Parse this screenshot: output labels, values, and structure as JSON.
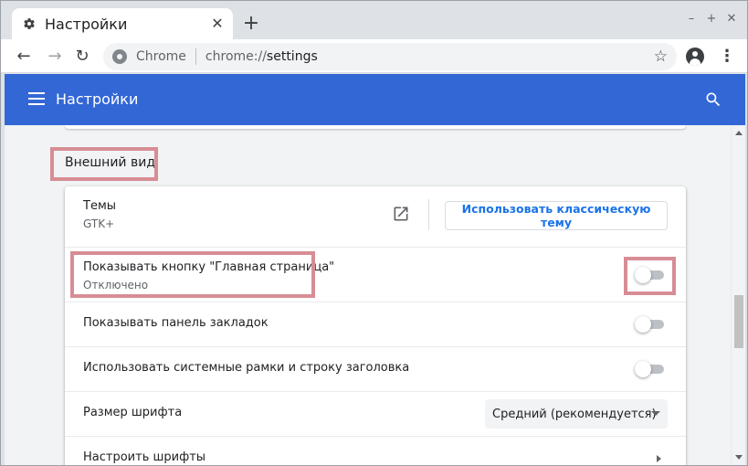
{
  "tab": {
    "title": "Настройки",
    "favicon": "gear-icon",
    "close": "✕"
  },
  "toolbar": {
    "back": "←",
    "forward": "→",
    "reload": "↻",
    "omnibox_chip": "Chrome",
    "url_scheme": "chrome://",
    "url_host": "settings",
    "star": "☆",
    "menu": "⋮",
    "new_tab": "+"
  },
  "window_controls": {
    "minimize": "–",
    "maximize": "+",
    "close": "✕"
  },
  "header": {
    "title": "Настройки",
    "accent": "#3367d6"
  },
  "appearance": {
    "section_title": "Внешний вид",
    "themes": {
      "label": "Темы",
      "value": "GTK+",
      "button": "Использовать классическую тему"
    },
    "home_button": {
      "label": "Показывать кнопку \"Главная страница\"",
      "status": "Отключено",
      "enabled": false
    },
    "bookmarks_bar": {
      "label": "Показывать панель закладок",
      "enabled": false
    },
    "system_frames": {
      "label": "Использовать системные рамки и строку заголовка",
      "enabled": false
    },
    "font_size": {
      "label": "Размер шрифта",
      "value": "Средний (рекомендуется)"
    },
    "customize_fonts": {
      "label": "Настроить шрифты"
    }
  },
  "highlight_color": "#d78d95"
}
